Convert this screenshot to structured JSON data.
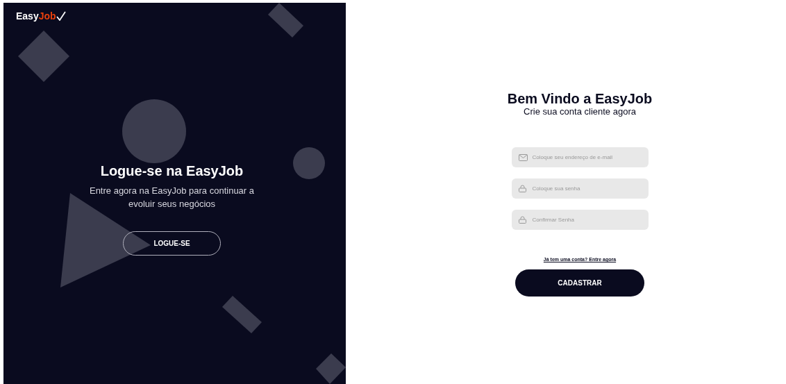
{
  "logo": [
    "Easy",
    "Job"
  ],
  "promo": {
    "title": "Logue-se na EasyJob",
    "text": "Entre agora na EasyJob para continuar a evoluir seus negócios",
    "button": "LOGUE-SE"
  },
  "form": {
    "title": "Bem Vindo a EasyJob",
    "subtitle": "Crie sua conta cliente agora",
    "fields": [
      {
        "kind": "email",
        "placeholder": "Coloque seu endereço de e-mail"
      },
      {
        "kind": "password",
        "placeholder": "Coloque sua senha"
      },
      {
        "kind": "password",
        "placeholder": "Confirmar Senha"
      }
    ],
    "login_link": "Já tem uma conta? Entre agora",
    "submit": "CADASTRAR"
  }
}
